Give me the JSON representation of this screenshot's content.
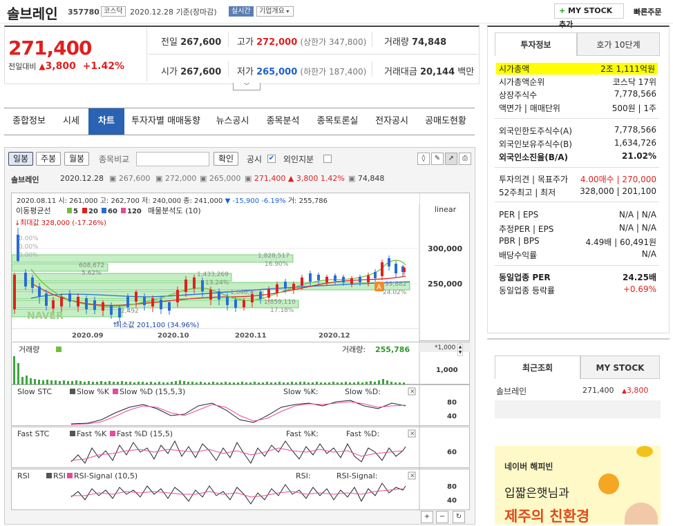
{
  "header": {
    "name": "솔브레인",
    "code": "357780",
    "market": "코스닥",
    "date": "2020.12.28 기준(장마감)",
    "realtime": "실시간",
    "overview": "기업개요",
    "mystock": "MY STOCK 추가",
    "quick": "빠른주문"
  },
  "price": {
    "current": "271,400",
    "prev_label": "전일대비",
    "change": "3,800",
    "change_pct": "+1.42%",
    "prev_close_label": "전일",
    "prev_close": "267,600",
    "high_label": "고가",
    "high": "272,000",
    "upper_limit": "(상한가 347,800)",
    "volume_label": "거래량",
    "volume": "74,848",
    "open_label": "시가",
    "open": "267,600",
    "low_label": "저가",
    "low": "265,000",
    "lower_limit": "(하한가 187,400)",
    "amount_label": "거래대금",
    "amount": "20,144",
    "amount_unit": "백만"
  },
  "tabs": [
    "종합정보",
    "시세",
    "차트",
    "투자자별 매매동향",
    "뉴스공시",
    "종목분석",
    "종목토론실",
    "전자공시",
    "공매도현황"
  ],
  "chart": {
    "buttons": [
      "일봉",
      "주봉",
      "월봉"
    ],
    "compare_label": "종목비교",
    "confirm": "확인",
    "disclosure": "공시",
    "foreign": "외인지분",
    "info": {
      "name": "솔브레인",
      "date": "2020.12.28",
      "open": "267,600",
      "high": "272,000",
      "low": "265,000",
      "close": "271,400",
      "chg": "3,800",
      "pct": "1.42%",
      "vol": "74,848"
    },
    "top_info": "2020.08.11 시: 261,000 고: 262,700 저: 240,000 종: 241,000",
    "top_chg": "-15,900",
    "top_pct": "-6.19%",
    "top_vol": "거: 255,786",
    "ma_label": "이동평균선",
    "ma": [
      "5",
      "20",
      "60",
      "120"
    ],
    "profile": "매물분석도 (10)",
    "linear": "linear",
    "max_label": "최대값 328,000 (-17.26%)",
    "min_label": "최소값 201,100 (34.96%)",
    "y_ticks": [
      "300,000",
      "250,000"
    ],
    "x_ticks": [
      "2020.09",
      "2020.10",
      "2020.11",
      "2020.12"
    ],
    "profile_labels": [
      "1,828,517",
      "16.90%",
      "608,672",
      "5.62%",
      "1,433,269",
      "13.24%",
      "1,646,4..",
      "1,859,110",
      "17.18%",
      "2,492",
      "99,882",
      "24.02%"
    ],
    "pct_labels": [
      "0.00%",
      "0.00%",
      "0.00%"
    ],
    "naver": "NAVER",
    "volume_title": "거래량",
    "volume_value_label": "거래량:",
    "volume_value": "255,786",
    "vol_unit": "*1,000",
    "vol_tick": "1,000",
    "slow_title": "Slow STC",
    "slow_k": "Slow %K",
    "slow_d": "Slow %D (15,5,3)",
    "slow_k2": "Slow %K:",
    "slow_d2": "Slow %D:",
    "slow_ticks": [
      "80",
      "40"
    ],
    "fast_title": "Fast STC",
    "fast_k": "Fast %K",
    "fast_d": "Fast %D (15,5)",
    "fast_k2": "Fast %K:",
    "fast_d2": "Fast %D:",
    "fast_ticks": [
      "60"
    ],
    "rsi_title": "RSI",
    "rsi_a": "RSI",
    "rsi_b": "RSI-Signal (10,5)",
    "rsi_a2": "RSI:",
    "rsi_b2": "RSI-Signal:",
    "rsi_ticks": [
      "80",
      "40"
    ]
  },
  "side": {
    "tabs": [
      "투자정보",
      "호가 10단계"
    ],
    "rows1": [
      [
        "시가총액",
        "2조 1,111억원"
      ],
      [
        "시가총액순위",
        "코스닥 17위"
      ],
      [
        "상장주식수",
        "7,778,566"
      ],
      [
        "액면가 | 매매단위",
        "500원 | 1주"
      ]
    ],
    "rows2": [
      [
        "외국인한도주식수(A)",
        "7,778,566"
      ],
      [
        "외국인보유주식수(B)",
        "1,634,726"
      ],
      [
        "외국인소진율(B/A)",
        "21.02%"
      ]
    ],
    "rows3": [
      [
        "투자의견 | 목표주가",
        "4.00매수 | 270,000"
      ],
      [
        "52주최고 | 최저",
        "328,000 | 201,100"
      ]
    ],
    "rows4": [
      [
        "PER | EPS",
        "N/A | N/A"
      ],
      [
        "추정PER | EPS",
        "N/A | N/A"
      ],
      [
        "PBR | BPS",
        "4.49배 | 60,491원"
      ],
      [
        "배당수익률",
        "N/A"
      ]
    ],
    "rows5": [
      [
        "동일업종 PER",
        "24.25배"
      ],
      [
        "동일업종 등락률",
        "+0.69%"
      ]
    ]
  },
  "recent": {
    "tabs": [
      "최근조회",
      "MY STOCK"
    ],
    "item": "솔브레인",
    "price": "271,400",
    "chg": "3,800"
  },
  "ad": {
    "brand": "네이버 해피빈",
    "line1": "입짧은햇님과",
    "line2": "제주의 친환경"
  },
  "colors": {
    "up": "#e01f1f",
    "down": "#1a5fd0",
    "accent": "#2a63b4",
    "highlight": "#ffff00"
  }
}
